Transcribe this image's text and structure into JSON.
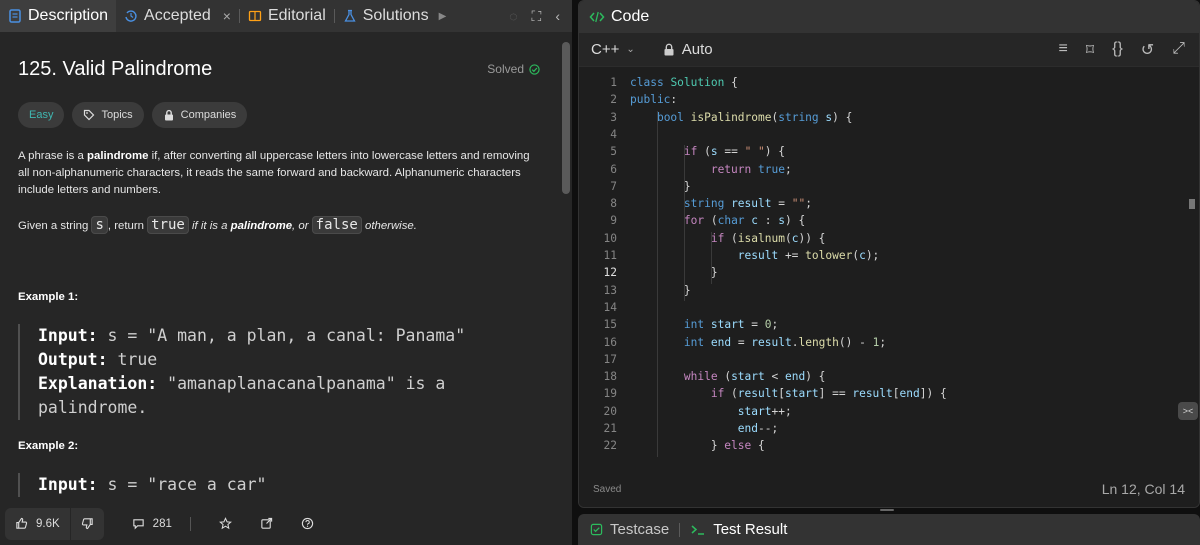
{
  "left_tabs": [
    {
      "label": "Description",
      "icon": "description-icon",
      "active": true
    },
    {
      "label": "Accepted",
      "icon": "history-icon",
      "active": false
    },
    {
      "label": "Editorial",
      "icon": "book-icon",
      "active": false
    },
    {
      "label": "Solutions",
      "icon": "flask-icon",
      "active": false
    }
  ],
  "problem": {
    "title": "125. Valid Palindrome",
    "status": "Solved",
    "difficulty": "Easy",
    "topics_label": "Topics",
    "companies_label": "Companies",
    "desc_p1_a": "A phrase is a ",
    "desc_p1_b": "palindrome",
    "desc_p1_c": " if, after converting all uppercase letters into lowercase letters and removing all non-alphanumeric characters, it reads the same forward and backward. Alphanumeric characters include letters and numbers.",
    "desc_p2_a": "Given a string ",
    "desc_p2_code1": "s",
    "desc_p2_b": ", return ",
    "desc_p2_code2": "true",
    "desc_p2_c": " if it is a ",
    "desc_p2_d": "palindrome",
    "desc_p2_e": ", or ",
    "desc_p2_code3": "false",
    "desc_p2_f": " otherwise."
  },
  "examples": [
    {
      "title": "Example 1:",
      "input_label": "Input:",
      "input": " s = \"A man, a plan, a canal: Panama\"",
      "output_label": "Output:",
      "output": " true",
      "explanation_label": "Explanation:",
      "explanation": " \"amanaplanacanalpanama\" is a",
      "explanation_cont": "palindrome."
    },
    {
      "title": "Example 2:",
      "input_label": "Input:",
      "input": " s = \"race a car\""
    }
  ],
  "footer": {
    "likes": "9.6K",
    "comments": "281"
  },
  "editor": {
    "panel_title": "Code",
    "language": "C++",
    "mode": "Auto",
    "saved": "Saved",
    "cursor": "Ln 12, Col 14",
    "current_line": 12,
    "lines": [
      "class Solution {",
      "public:",
      "    bool isPalindrome(string s) {",
      "",
      "        if (s == \" \") {",
      "            return true;",
      "        }",
      "        string result = \"\";",
      "        for (char c : s) {",
      "            if (isalnum(c)) {",
      "                result += tolower(c);",
      "            }",
      "        }",
      "",
      "        int start = 0;",
      "        int end = result.length() - 1;",
      "",
      "        while (start < end) {",
      "            if (result[start] == result[end]) {",
      "                start++;",
      "                end--;",
      "            } else {"
    ]
  },
  "bottom_tabs": [
    {
      "label": "Testcase",
      "icon": "checkbox-icon",
      "active": false
    },
    {
      "label": "Test Result",
      "icon": "terminal-icon",
      "active": true
    }
  ],
  "colors": {
    "easy": "#40b6b0",
    "solved_check": "#2cbb5d",
    "accent_blue": "#4a90e2",
    "editorial_icon": "#ffa116"
  }
}
